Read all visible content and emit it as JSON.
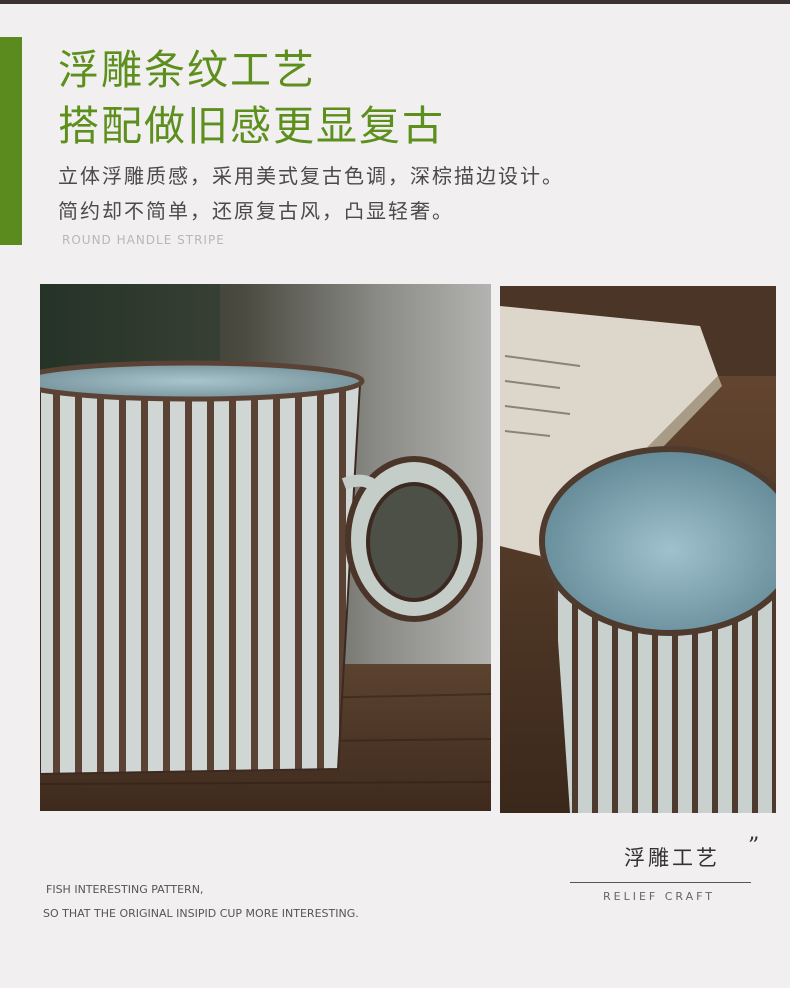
{
  "header": {
    "title_line1": "浮雕条纹工艺",
    "title_line2": "搭配做旧感更显复古",
    "desc_line1": "立体浮雕质感，采用美式复古色调，深棕描边设计。",
    "desc_line2": "简约却不简单，还原复古风，凸显轻奢。",
    "subtitle_en": "ROUND HANDLE STRIPE"
  },
  "craft": {
    "label_cn": "浮雕工艺",
    "quote": "”",
    "label_en": "RELIEF CRAFT"
  },
  "footer": {
    "line1": "FISH INTERESTING PATTERN,",
    "line2": "SO THAT THE ORIGINAL INSIPID CUP MORE INTERESTING."
  },
  "colors": {
    "accent_green": "#5b8a1f",
    "title_green": "#5d8f1d",
    "background": "#f2eff1"
  }
}
